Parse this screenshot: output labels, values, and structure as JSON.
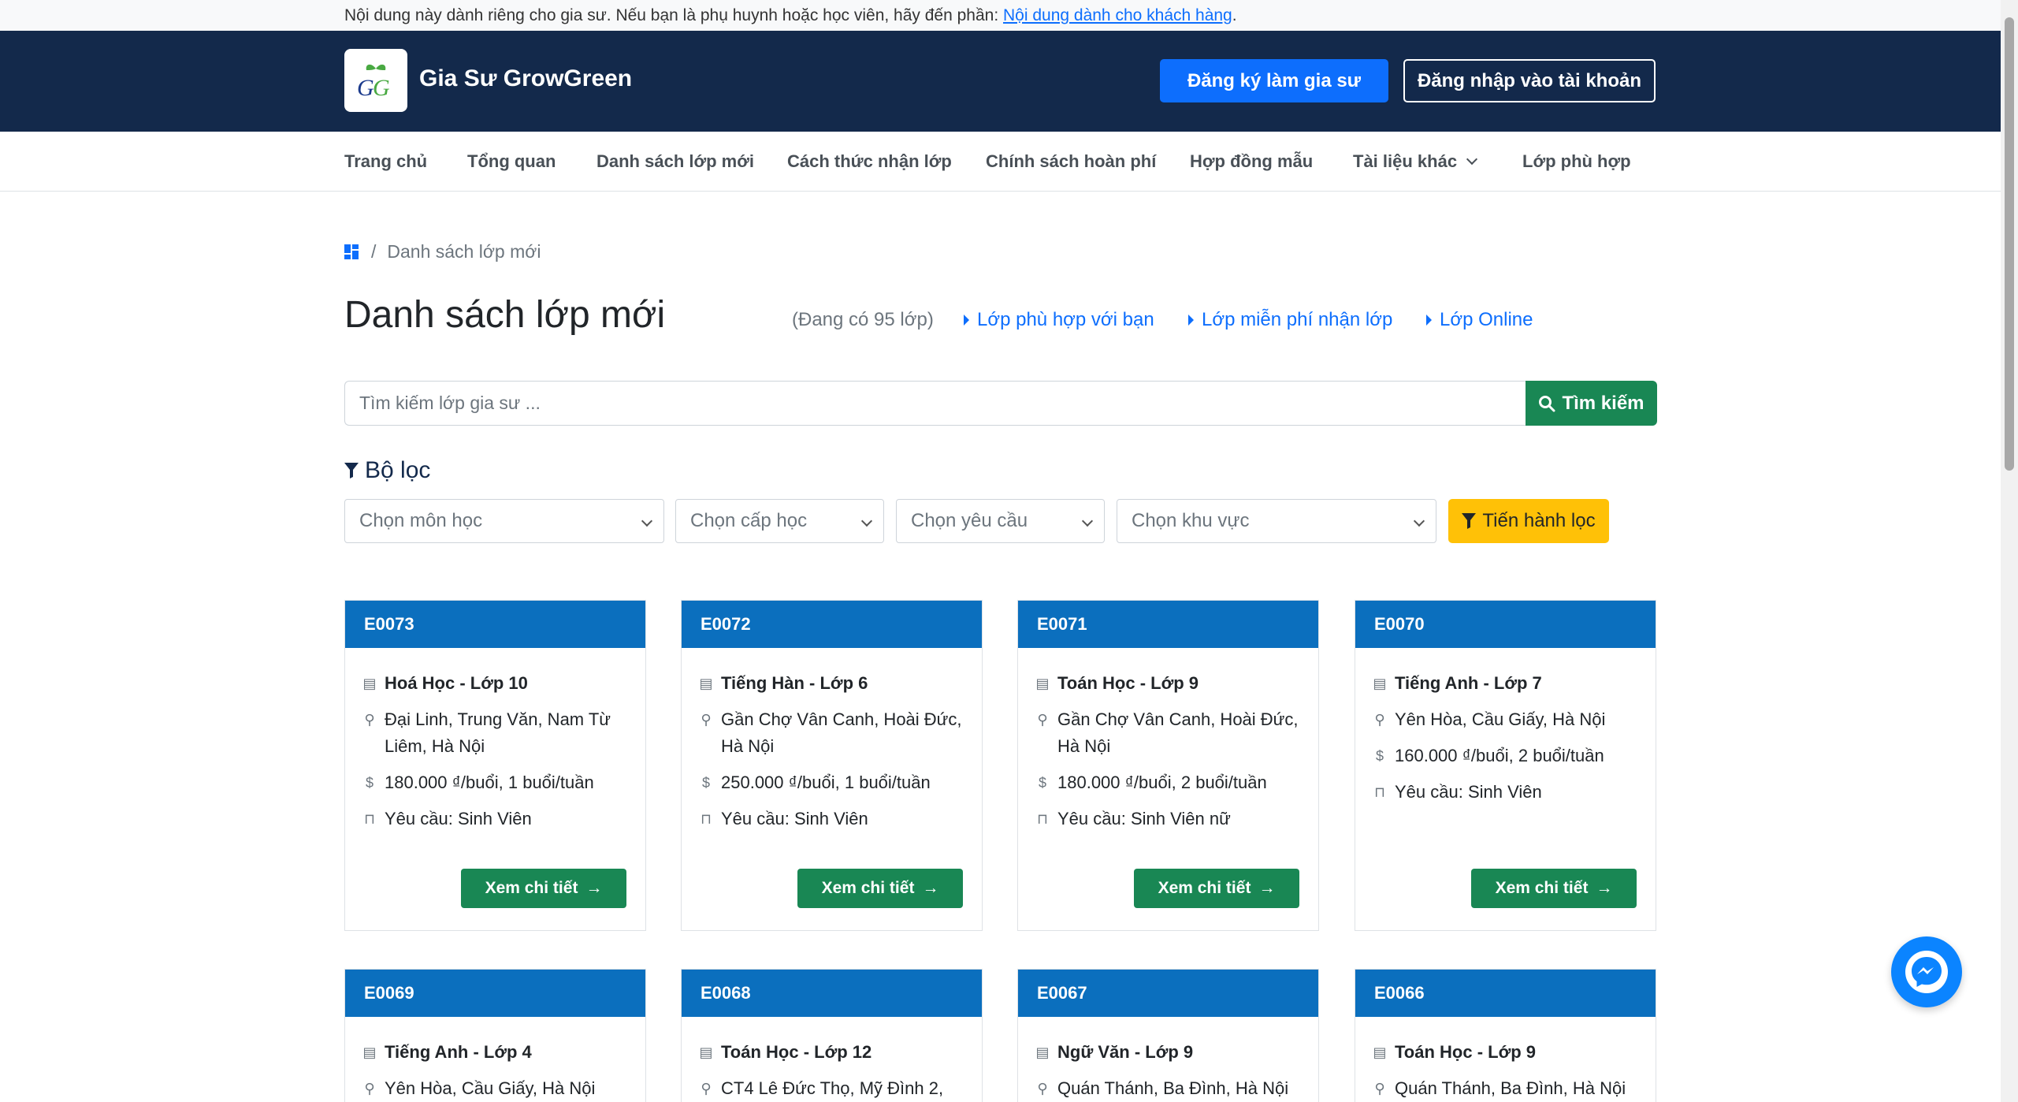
{
  "notice": {
    "text": "Nội dung này dành riêng cho gia sư. Nếu bạn là phụ huynh hoặc học viên, hãy đến phần: ",
    "link": "Nội dung dành cho khách hàng",
    "suffix": "."
  },
  "header": {
    "brand": "Gia Sư GrowGreen",
    "register_label": "Đăng ký làm gia sư",
    "login_label": "Đăng nhập vào tài khoản"
  },
  "nav": {
    "items": [
      "Trang chủ",
      "Tổng quan",
      "Danh sách lớp mới",
      "Cách thức nhận lớp",
      "Chính sách hoàn phí",
      "Hợp đồng mẫu",
      "Tài liệu khác",
      "Lớp phù hợp"
    ]
  },
  "breadcrumb": {
    "current": "Danh sách lớp mới"
  },
  "page": {
    "title": "Danh sách lớp mới",
    "count": "(Đang có 95 lớp)",
    "links": [
      "Lớp phù hợp với bạn",
      "Lớp miễn phí nhận lớp",
      "Lớp Online"
    ]
  },
  "search": {
    "placeholder": "Tìm kiếm lớp gia sư ...",
    "button": "Tìm kiếm"
  },
  "filter": {
    "title": "Bộ lọc",
    "subject": "Chọn môn học",
    "level": "Chọn cấp học",
    "requirement": "Chọn yêu cầu",
    "area": "Chọn khu vực",
    "apply": "Tiến hành lọc"
  },
  "cards": [
    {
      "code": "E0073",
      "title": "Hoá Học - Lớp 10",
      "location": "Đại Linh, Trung Văn, Nam Từ Liêm, Hà Nội",
      "fee": "180.000 ₫/buổi, 1 buổi/tuần",
      "req": "Yêu cầu: Sinh Viên",
      "button": "Xem chi tiết"
    },
    {
      "code": "E0072",
      "title": "Tiếng Hàn - Lớp 6",
      "location": "Gần Chợ Vân Canh, Hoài Đức, Hà Nội",
      "fee": "250.000 ₫/buổi, 1 buổi/tuần",
      "req": "Yêu cầu: Sinh Viên",
      "button": "Xem chi tiết"
    },
    {
      "code": "E0071",
      "title": "Toán Học - Lớp 9",
      "location": "Gần Chợ Vân Canh, Hoài Đức, Hà Nội",
      "fee": "180.000 ₫/buổi, 2 buổi/tuần",
      "req": "Yêu cầu: Sinh Viên nữ",
      "button": "Xem chi tiết"
    },
    {
      "code": "E0070",
      "title": "Tiếng Anh - Lớp 7",
      "location": "Yên Hòa, Cầu Giấy, Hà Nội",
      "fee": "160.000 ₫/buổi, 2 buổi/tuần",
      "req": "Yêu cầu: Sinh Viên",
      "button": "Xem chi tiết"
    },
    {
      "code": "E0069",
      "title": "Tiếng Anh - Lớp 4",
      "location": "Yên Hòa, Cầu Giấy, Hà Nội"
    },
    {
      "code": "E0068",
      "title": "Toán Học - Lớp 12",
      "location": "CT4 Lê Đức Thọ, Mỹ Đình 2,"
    },
    {
      "code": "E0067",
      "title": "Ngữ Văn - Lớp 9",
      "location": "Quán Thánh, Ba Đình, Hà Nội"
    },
    {
      "code": "E0066",
      "title": "Toán Học - Lớp 9",
      "location": "Quán Thánh, Ba Đình, Hà Nội"
    }
  ],
  "colors": {
    "header_bg": "#13294b",
    "primary": "#0d6efd",
    "success": "#198754",
    "warning": "#ffc107",
    "card_head": "#0b6fbe"
  }
}
